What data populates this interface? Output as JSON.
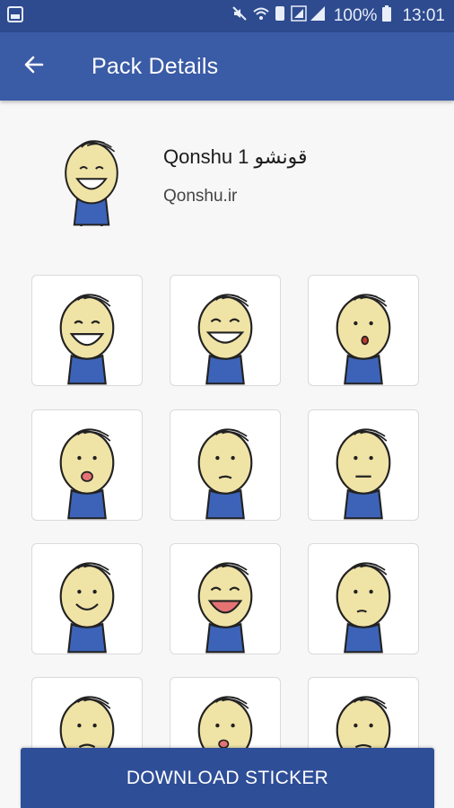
{
  "status_bar": {
    "icons": [
      "image-icon",
      "mute-icon",
      "wifi-icon",
      "signal-icon",
      "battery-icon"
    ],
    "battery": "100%",
    "time": "13:01"
  },
  "app_bar": {
    "back_icon": "arrow-left-icon",
    "title": "Pack Details"
  },
  "pack": {
    "name": "Qonshu 1 قونشو",
    "publisher": "Qonshu.ir"
  },
  "stickers": [
    {
      "expression": "big-smile"
    },
    {
      "expression": "grin-closed-eyes"
    },
    {
      "expression": "surprised"
    },
    {
      "expression": "shocked-hands-on-head"
    },
    {
      "expression": "sleepy"
    },
    {
      "expression": "neutral"
    },
    {
      "expression": "smile"
    },
    {
      "expression": "laughing"
    },
    {
      "expression": "thinking"
    },
    {
      "expression": "angry"
    },
    {
      "expression": "sad-thumbs"
    },
    {
      "expression": "worried"
    }
  ],
  "download_button": {
    "label": "DOWNLOAD STICKER"
  },
  "colors": {
    "status_bar": "#2e4b8f",
    "app_bar": "#3a5ba6",
    "button": "#2f4e98",
    "background": "#f7f7f7",
    "character_skin": "#f0e3a6",
    "character_shirt": "#3d63b8"
  }
}
